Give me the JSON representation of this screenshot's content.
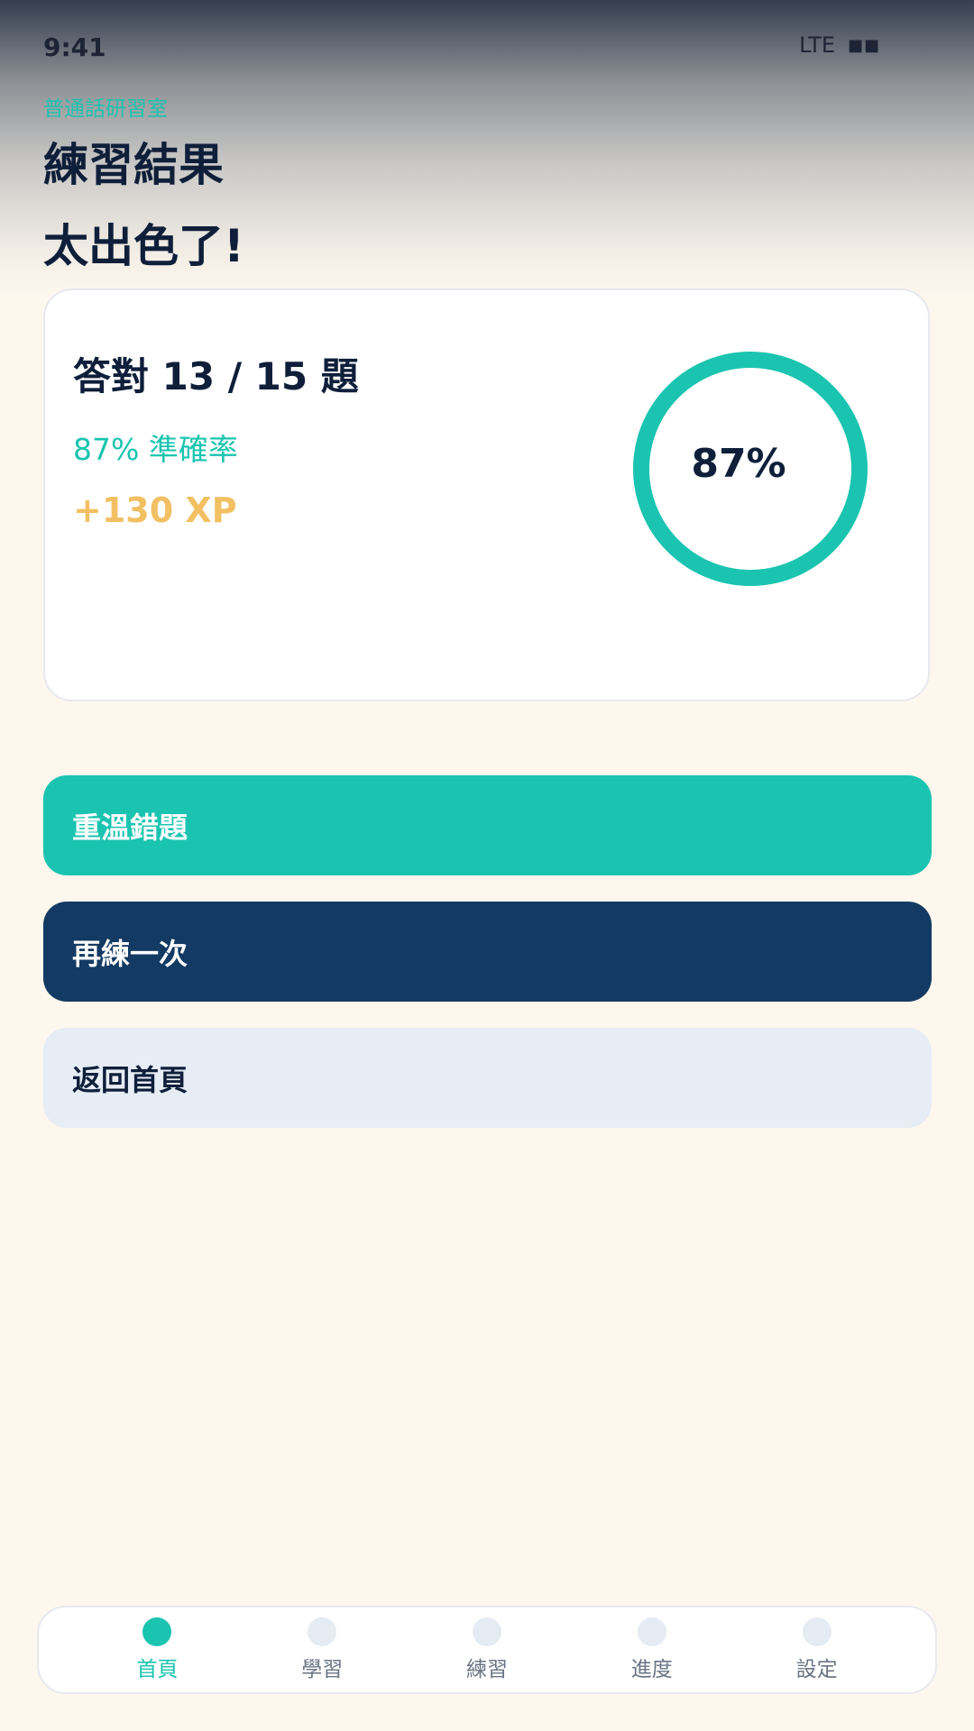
{
  "status_bar": {
    "time": "9:41",
    "network": "LTE",
    "battery": "■■"
  },
  "header": {
    "subtitle": "普通話研習室",
    "title": "練習結果",
    "praise": "太出色了!"
  },
  "result": {
    "score_text": "答對 13 / 15 題",
    "accuracy_text": "87% 準確率",
    "xp_text": "+130 XP",
    "ring_label": "87%",
    "ring_fraction": 0.87
  },
  "actions": {
    "review_label": "重溫錯題",
    "retry_label": "再練一次",
    "home_label": "返回首頁"
  },
  "nav": {
    "items": [
      {
        "label": "首頁",
        "active": true
      },
      {
        "label": "學習",
        "active": false
      },
      {
        "label": "練習",
        "active": false
      },
      {
        "label": "進度",
        "active": false
      },
      {
        "label": "設定",
        "active": false
      }
    ]
  },
  "colors": {
    "accent": "#1bc4b0",
    "navy": "#133a62",
    "xp": "#f2c063",
    "background": "#fdf7ee",
    "light_button": "#e7edf5"
  }
}
